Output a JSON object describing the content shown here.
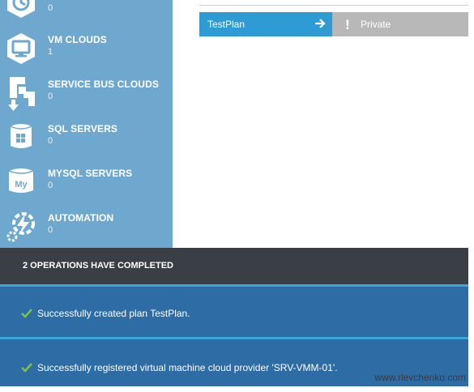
{
  "sidebar": {
    "items": [
      {
        "label": "",
        "count": "0",
        "icon": "clock-icon"
      },
      {
        "label": "VM CLOUDS",
        "count": "1",
        "icon": "monitor-icon"
      },
      {
        "label": "SERVICE BUS CLOUDS",
        "count": "0",
        "icon": "service-bus-icon"
      },
      {
        "label": "SQL SERVERS",
        "count": "0",
        "icon": "sql-database-icon"
      },
      {
        "label": "MYSQL SERVERS",
        "count": "0",
        "icon": "mysql-database-icon"
      },
      {
        "label": "AUTOMATION",
        "count": "0",
        "icon": "automation-gear-icon"
      }
    ]
  },
  "plans": [
    {
      "name": "TestPlan",
      "status": "Private",
      "status_icon": "!"
    }
  ],
  "notifications": {
    "header": "2 OPERATIONS HAVE COMPLETED",
    "messages": [
      "Successfully created plan TestPlan.",
      "Successfully registered virtual machine cloud provider 'SRV-VMM-01'."
    ]
  },
  "watermark": "www.rlevchenko.com",
  "colors": {
    "sidebar": "#6fa8cf",
    "plan_accent": "#2f9bd5",
    "status_gray": "#b8b8b8",
    "notification_header": "#3a3f45",
    "notification_bar": "#2e6ca5",
    "success_check": "#7cc242"
  }
}
